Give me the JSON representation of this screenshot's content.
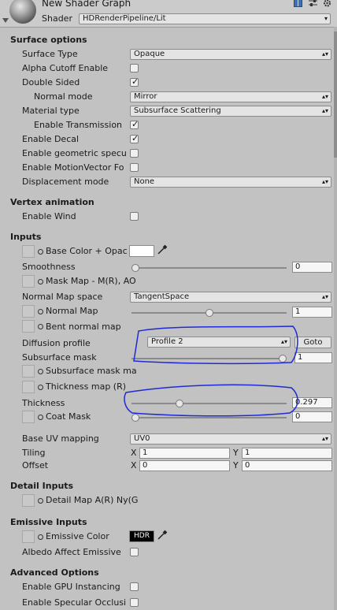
{
  "header": {
    "title": "New Shader Graph",
    "shader_label": "Shader",
    "shader_value": "HDRenderPipeline/Lit",
    "icons": [
      "book-icon",
      "sliders-icon",
      "gear-icon"
    ]
  },
  "surface_options": {
    "title": "Surface options",
    "surface_type": {
      "label": "Surface Type",
      "value": "Opaque"
    },
    "alpha_cutoff": {
      "label": "Alpha Cutoff Enable",
      "checked": false
    },
    "double_sided": {
      "label": "Double Sided",
      "checked": true
    },
    "normal_mode": {
      "label": "Normal mode",
      "value": "Mirror"
    },
    "material_type": {
      "label": "Material type",
      "value": "Subsurface Scattering"
    },
    "enable_transmission": {
      "label": "Enable Transmission",
      "checked": true
    },
    "enable_decal": {
      "label": "Enable Decal",
      "checked": true
    },
    "enable_geometric": {
      "label": "Enable geometric specu",
      "checked": false
    },
    "enable_motion_vector": {
      "label": "Enable MotionVector Fo",
      "checked": false
    },
    "displacement_mode": {
      "label": "Displacement mode",
      "value": "None"
    }
  },
  "vertex_animation": {
    "title": "Vertex animation",
    "enable_wind": {
      "label": "Enable Wind",
      "checked": false
    }
  },
  "inputs": {
    "title": "Inputs",
    "base_color": {
      "label": "Base Color + Opac",
      "color": "#ffffff"
    },
    "smoothness": {
      "label": "Smoothness",
      "value": "0",
      "fraction": 0.0
    },
    "mask_map": {
      "label": "Mask Map - M(R), AO"
    },
    "normal_map_space": {
      "label": "Normal Map space",
      "value": "TangentSpace"
    },
    "normal_map": {
      "label": "Normal Map",
      "value": "1",
      "fraction": 0.5
    },
    "bent_normal_map": {
      "label": "Bent normal map"
    },
    "diffusion_profile": {
      "label": "Diffusion profile",
      "value": "Profile 2",
      "button": "Goto"
    },
    "subsurface_mask": {
      "label": "Subsurface mask",
      "value": "1",
      "fraction": 1.0
    },
    "subsurface_mask_map": {
      "label": "Subsurface mask ma"
    },
    "thickness_map": {
      "label": "Thickness map (R)"
    },
    "thickness": {
      "label": "Thickness",
      "value": "0.297",
      "fraction": 0.297
    },
    "coat_mask": {
      "label": "Coat Mask",
      "value": "0",
      "fraction": 0.0
    },
    "base_uv_mapping": {
      "label": "Base UV mapping",
      "value": "UV0"
    },
    "tiling": {
      "label": "Tiling",
      "x_label": "X",
      "x": "1",
      "y_label": "Y",
      "y": "1"
    },
    "offset": {
      "label": "Offset",
      "x_label": "X",
      "x": "0",
      "y_label": "Y",
      "y": "0"
    }
  },
  "detail_inputs": {
    "title": "Detail Inputs",
    "detail_map": {
      "label": "Detail Map A(R) Ny(G"
    }
  },
  "emissive_inputs": {
    "title": "Emissive Inputs",
    "emissive_color": {
      "label": "Emissive Color",
      "swatch_text": "HDR"
    },
    "albedo_affect": {
      "label": "Albedo Affect Emissive",
      "checked": false
    }
  },
  "advanced_options": {
    "title": "Advanced Options",
    "gpu_instancing": {
      "label": "Enable GPU Instancing",
      "checked": false
    },
    "specular_occlusion": {
      "label": "Enable Specular Occlusi",
      "checked": false
    }
  },
  "colors": {
    "background": "#c2c2c2",
    "annotation": "#1f2bd6"
  }
}
